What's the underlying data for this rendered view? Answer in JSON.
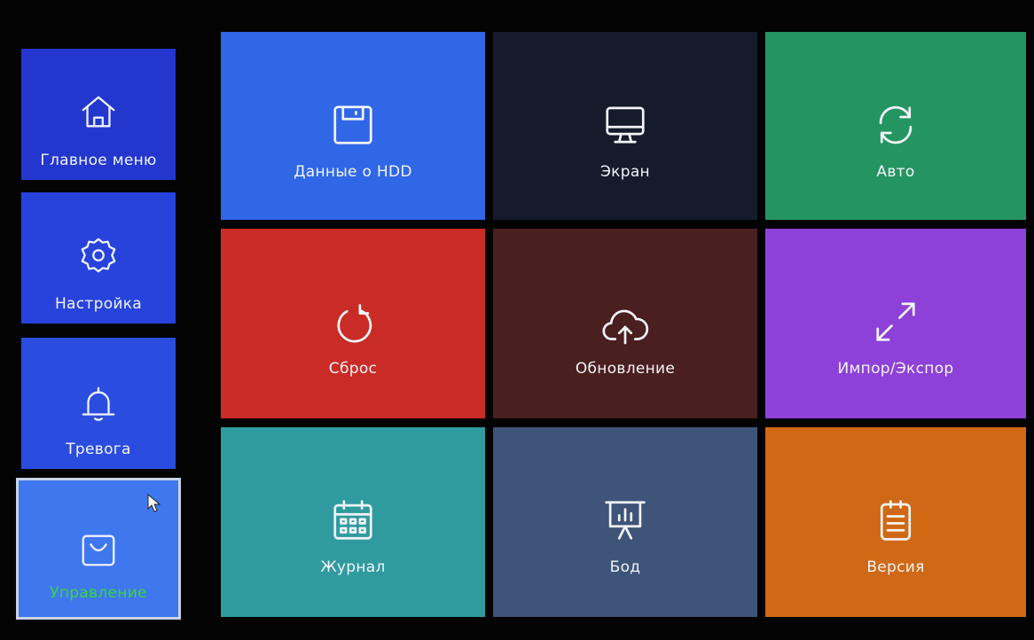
{
  "sidebar": {
    "items": [
      {
        "label": "Главное меню",
        "icon": "home-icon",
        "color": "#2337cf"
      },
      {
        "label": "Настройка",
        "icon": "settings-icon",
        "color": "#2743db"
      },
      {
        "label": "Тревога",
        "icon": "bell-icon",
        "color": "#2b4ddf"
      },
      {
        "label": "Управление",
        "icon": "shopping-bag-icon",
        "color": "#3f77ee",
        "selected": true
      }
    ]
  },
  "tiles": [
    {
      "label": "Данные о HDD",
      "icon": "floppy-disk-icon",
      "color": "#2f67e6"
    },
    {
      "label": "Экран",
      "icon": "monitor-icon",
      "color": "#151b2b"
    },
    {
      "label": "Авто",
      "icon": "sync-icon",
      "color": "#249561"
    },
    {
      "label": "Сброс",
      "icon": "restart-icon",
      "color": "#c92c26"
    },
    {
      "label": "Обновление",
      "icon": "cloud-upload-icon",
      "color": "#4a1f1f"
    },
    {
      "label": "Импор/Экспор",
      "icon": "expand-arrows-icon",
      "color": "#8e41d8"
    },
    {
      "label": "Журнал",
      "icon": "calendar-icon",
      "color": "#2f9b9f"
    },
    {
      "label": "Бод",
      "icon": "presentation-chart-icon",
      "color": "#3e5479"
    },
    {
      "label": "Версия",
      "icon": "notepad-icon",
      "color": "#cf6915"
    }
  ]
}
